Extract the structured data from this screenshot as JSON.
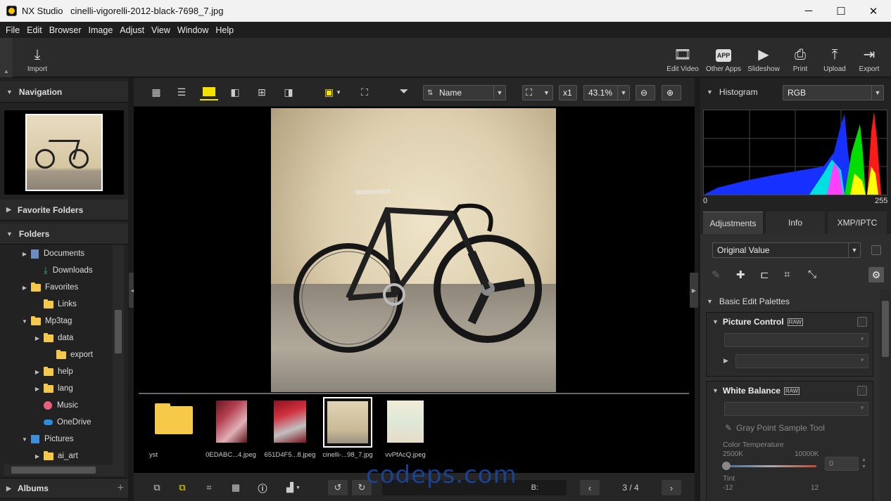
{
  "window": {
    "app_title": "NX Studio",
    "file_title": "cinelli-vigorelli-2012-black-7698_7.jpg",
    "minimize": "─",
    "maximize": "☐",
    "close": "✕"
  },
  "menu": [
    "File",
    "Edit",
    "Browser",
    "Image",
    "Adjust",
    "View",
    "Window",
    "Help"
  ],
  "toolbar": {
    "import": "Import",
    "edit_video": "Edit Video",
    "other_apps": "Other Apps",
    "slideshow": "Slideshow",
    "print": "Print",
    "upload": "Upload",
    "export": "Export"
  },
  "left": {
    "navigation": "Navigation",
    "favorite_folders": "Favorite Folders",
    "folders": "Folders",
    "albums": "Albums",
    "tree": [
      {
        "label": "Documents",
        "level": 1,
        "expandable": true
      },
      {
        "label": "Downloads",
        "level": 1,
        "expandable": false
      },
      {
        "label": "Favorites",
        "level": 1,
        "expandable": true
      },
      {
        "label": "Links",
        "level": 1,
        "expandable": false
      },
      {
        "label": "Mp3tag",
        "level": 1,
        "expandable": true,
        "expanded": true
      },
      {
        "label": "data",
        "level": 2,
        "expandable": true
      },
      {
        "label": "export",
        "level": 2,
        "expandable": false
      },
      {
        "label": "help",
        "level": 2,
        "expandable": true
      },
      {
        "label": "lang",
        "level": 2,
        "expandable": true
      },
      {
        "label": "Music",
        "level": 1,
        "expandable": false
      },
      {
        "label": "OneDrive",
        "level": 1,
        "expandable": false
      },
      {
        "label": "Pictures",
        "level": 1,
        "expandable": true,
        "expanded": true
      },
      {
        "label": "ai_art",
        "level": 2,
        "expandable": true
      }
    ]
  },
  "viewer": {
    "sort_label": "Name",
    "magnify": "x1",
    "zoom": "43.1%",
    "thumbnails": [
      {
        "label": "yst"
      },
      {
        "label": "0EDABC...4.jpeg"
      },
      {
        "label": "651D4F5...8.jpeg"
      },
      {
        "label": "cinelli-...98_7.jpg"
      },
      {
        "label": "vvPfAcQ.jpeg"
      }
    ],
    "page_counter": "3 / 4",
    "rating_label": "B:"
  },
  "right": {
    "histogram": "Histogram",
    "channel": "RGB",
    "hist_min": "0",
    "hist_max": "255",
    "tabs": [
      "Adjustments",
      "Info",
      "XMP/IPTC"
    ],
    "preset": "Original Value",
    "basic_edit": "Basic Edit Palettes",
    "picture_control": "Picture Control",
    "white_balance": "White Balance",
    "raw_badge": "RAW",
    "gray_point": "Gray Point Sample Tool",
    "color_temp": "Color Temperature",
    "ct_min": "2500K",
    "ct_max": "10000K",
    "ct_value": "0",
    "tint": "Tint",
    "tint_min": "-12",
    "tint_max": "12"
  },
  "watermark": "codeps.com",
  "colors": {
    "accent": "#f5e100",
    "panel": "#222222"
  }
}
